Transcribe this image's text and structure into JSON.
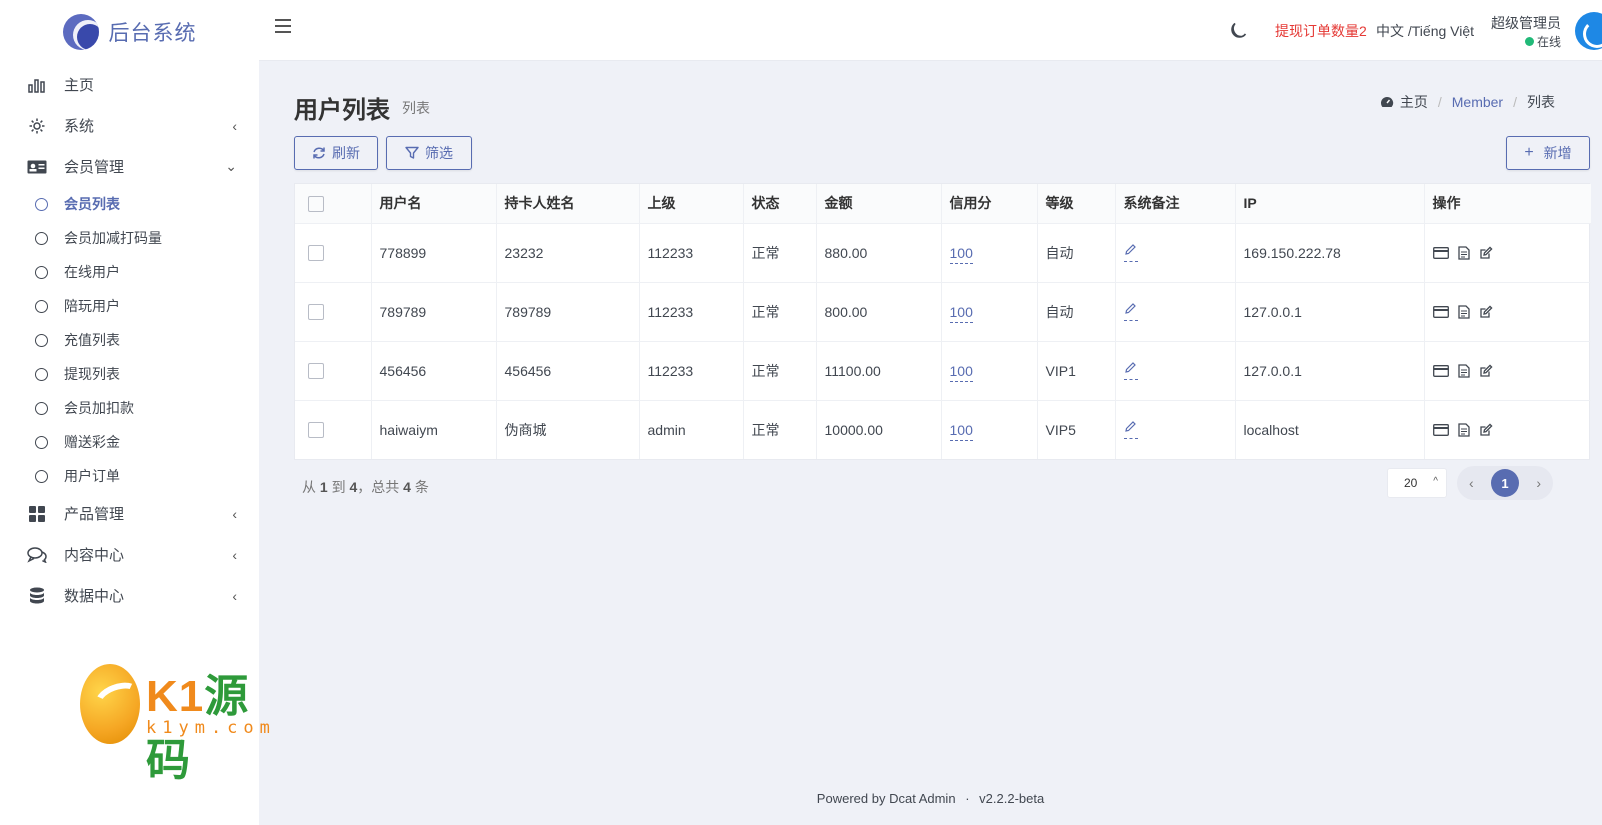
{
  "brand": {
    "name": "后台系统"
  },
  "sidebar": {
    "items": [
      {
        "label": "主页",
        "icon": "bar-chart-icon",
        "has_children": false
      },
      {
        "label": "系统",
        "icon": "gear-icon",
        "has_children": true,
        "expanded": false
      },
      {
        "label": "会员管理",
        "icon": "id-card-icon",
        "has_children": true,
        "expanded": true,
        "children": [
          {
            "label": "会员列表",
            "active": true
          },
          {
            "label": "会员加减打码量",
            "active": false
          },
          {
            "label": "在线用户",
            "active": false
          },
          {
            "label": "陪玩用户",
            "active": false
          },
          {
            "label": "充值列表",
            "active": false
          },
          {
            "label": "提现列表",
            "active": false
          },
          {
            "label": "会员加扣款",
            "active": false
          },
          {
            "label": "赠送彩金",
            "active": false
          },
          {
            "label": "用户订单",
            "active": false
          }
        ]
      },
      {
        "label": "产品管理",
        "icon": "grid-icon",
        "has_children": true,
        "expanded": false
      },
      {
        "label": "内容中心",
        "icon": "comments-icon",
        "has_children": true,
        "expanded": false
      },
      {
        "label": "数据中心",
        "icon": "database-icon",
        "has_children": true,
        "expanded": false
      }
    ]
  },
  "watermark": {
    "main": "K1",
    "main_cn": "源码",
    "sub": "k1ym.com"
  },
  "header": {
    "alert": "提现订单数量2",
    "language": "中文 /Tiếng Việt",
    "user_name": "超级管理员",
    "user_status": "在线"
  },
  "page": {
    "title": "用户列表",
    "subtitle": "列表",
    "breadcrumb": [
      "主页",
      "Member",
      "列表"
    ]
  },
  "toolbar": {
    "refresh": "刷新",
    "filter": "筛选",
    "add": "新增"
  },
  "table": {
    "columns": [
      "用户名",
      "持卡人姓名",
      "上级",
      "状态",
      "金额",
      "信用分",
      "等级",
      "系统备注",
      "IP",
      "操作"
    ],
    "rows": [
      {
        "username": "778899",
        "cardholder": "23232",
        "parent": "112233",
        "status": "正常",
        "amount": "880.00",
        "credit": "100",
        "level": "自动",
        "ip": "169.150.222.78"
      },
      {
        "username": "789789",
        "cardholder": "789789",
        "parent": "112233",
        "status": "正常",
        "amount": "800.00",
        "credit": "100",
        "level": "自动",
        "ip": "127.0.0.1"
      },
      {
        "username": "456456",
        "cardholder": "456456",
        "parent": "112233",
        "status": "正常",
        "amount": "11100.00",
        "credit": "100",
        "level": "VIP1",
        "ip": "127.0.0.1"
      },
      {
        "username": "haiwaiym",
        "cardholder": "伪商城",
        "parent": "admin",
        "status": "正常",
        "amount": "10000.00",
        "credit": "100",
        "level": "VIP5",
        "ip": "localhost"
      }
    ]
  },
  "pagination": {
    "summary_prefix": "从",
    "from": "1",
    "to_word": "到",
    "to": "4",
    "total_prefix": "，总共",
    "total": "4",
    "total_suffix": "条",
    "per_page": "20",
    "current_page": "1"
  },
  "footer": {
    "powered": "Powered by",
    "product": "Dcat Admin",
    "version": "v2.2.2-beta"
  },
  "colors": {
    "accent": "#586cb1",
    "alert": "#e53935",
    "online": "#21b978",
    "background": "#eff1f7"
  }
}
